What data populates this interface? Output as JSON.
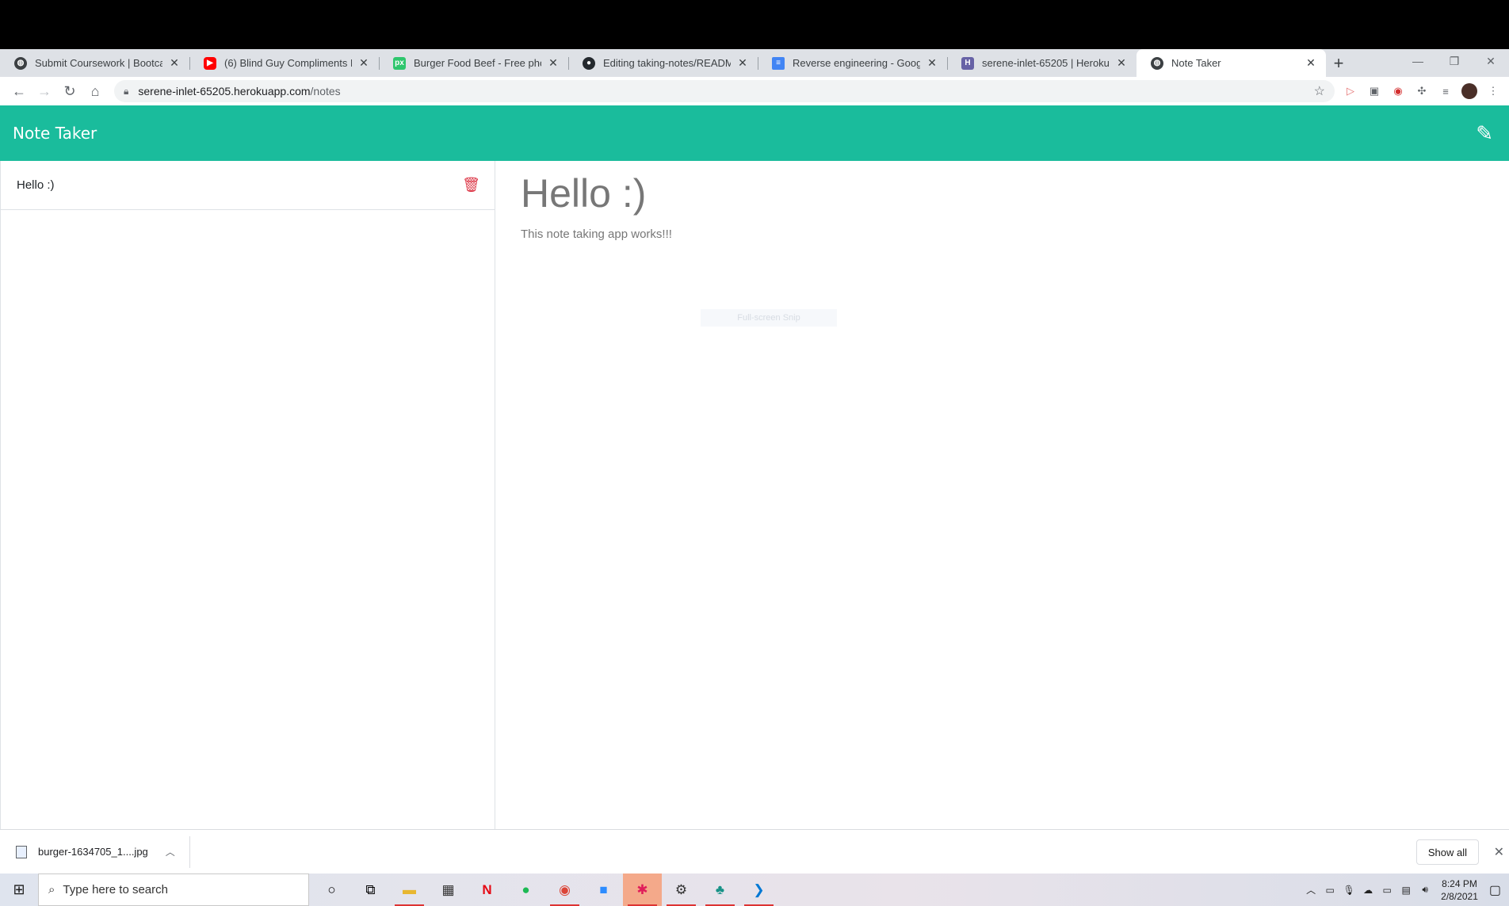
{
  "browser": {
    "tabs": [
      {
        "title": "Submit Coursework | Bootcamp S",
        "favicon": "globe-icon",
        "color": "#3c4043"
      },
      {
        "title": "(6) Blind Guy Compliments Peopl",
        "favicon": "youtube-icon",
        "color": "#ff0000"
      },
      {
        "title": "Burger Food Beef - Free photo o",
        "favicon": "pixabay-icon",
        "color": "#2ec66d"
      },
      {
        "title": "Editing taking-notes/README.m",
        "favicon": "github-icon",
        "color": "#24292e"
      },
      {
        "title": "Reverse engineering - Google Do",
        "favicon": "google-docs-icon",
        "color": "#4285f4"
      },
      {
        "title": "serene-inlet-65205 | Heroku",
        "favicon": "heroku-icon",
        "color": "#6762a6"
      },
      {
        "title": "Note Taker",
        "favicon": "globe-icon",
        "color": "#3c4043",
        "active": true
      }
    ],
    "url_host": "serene-inlet-65205.herokuapp.com",
    "url_path": "/notes"
  },
  "app": {
    "brand": "Note Taker",
    "accent_color": "#1abc9c",
    "notes": [
      {
        "title": "Hello :)"
      }
    ],
    "active_note": {
      "title": "Hello :)",
      "text": "This note taking app works!!!"
    },
    "snip_overlay": "Full-screen Snip"
  },
  "download_bar": {
    "file_name": "burger-1634705_1....jpg",
    "show_all": "Show all"
  },
  "taskbar": {
    "search_placeholder": "Type here to search",
    "time": "8:24 PM",
    "date": "2/8/2021"
  }
}
